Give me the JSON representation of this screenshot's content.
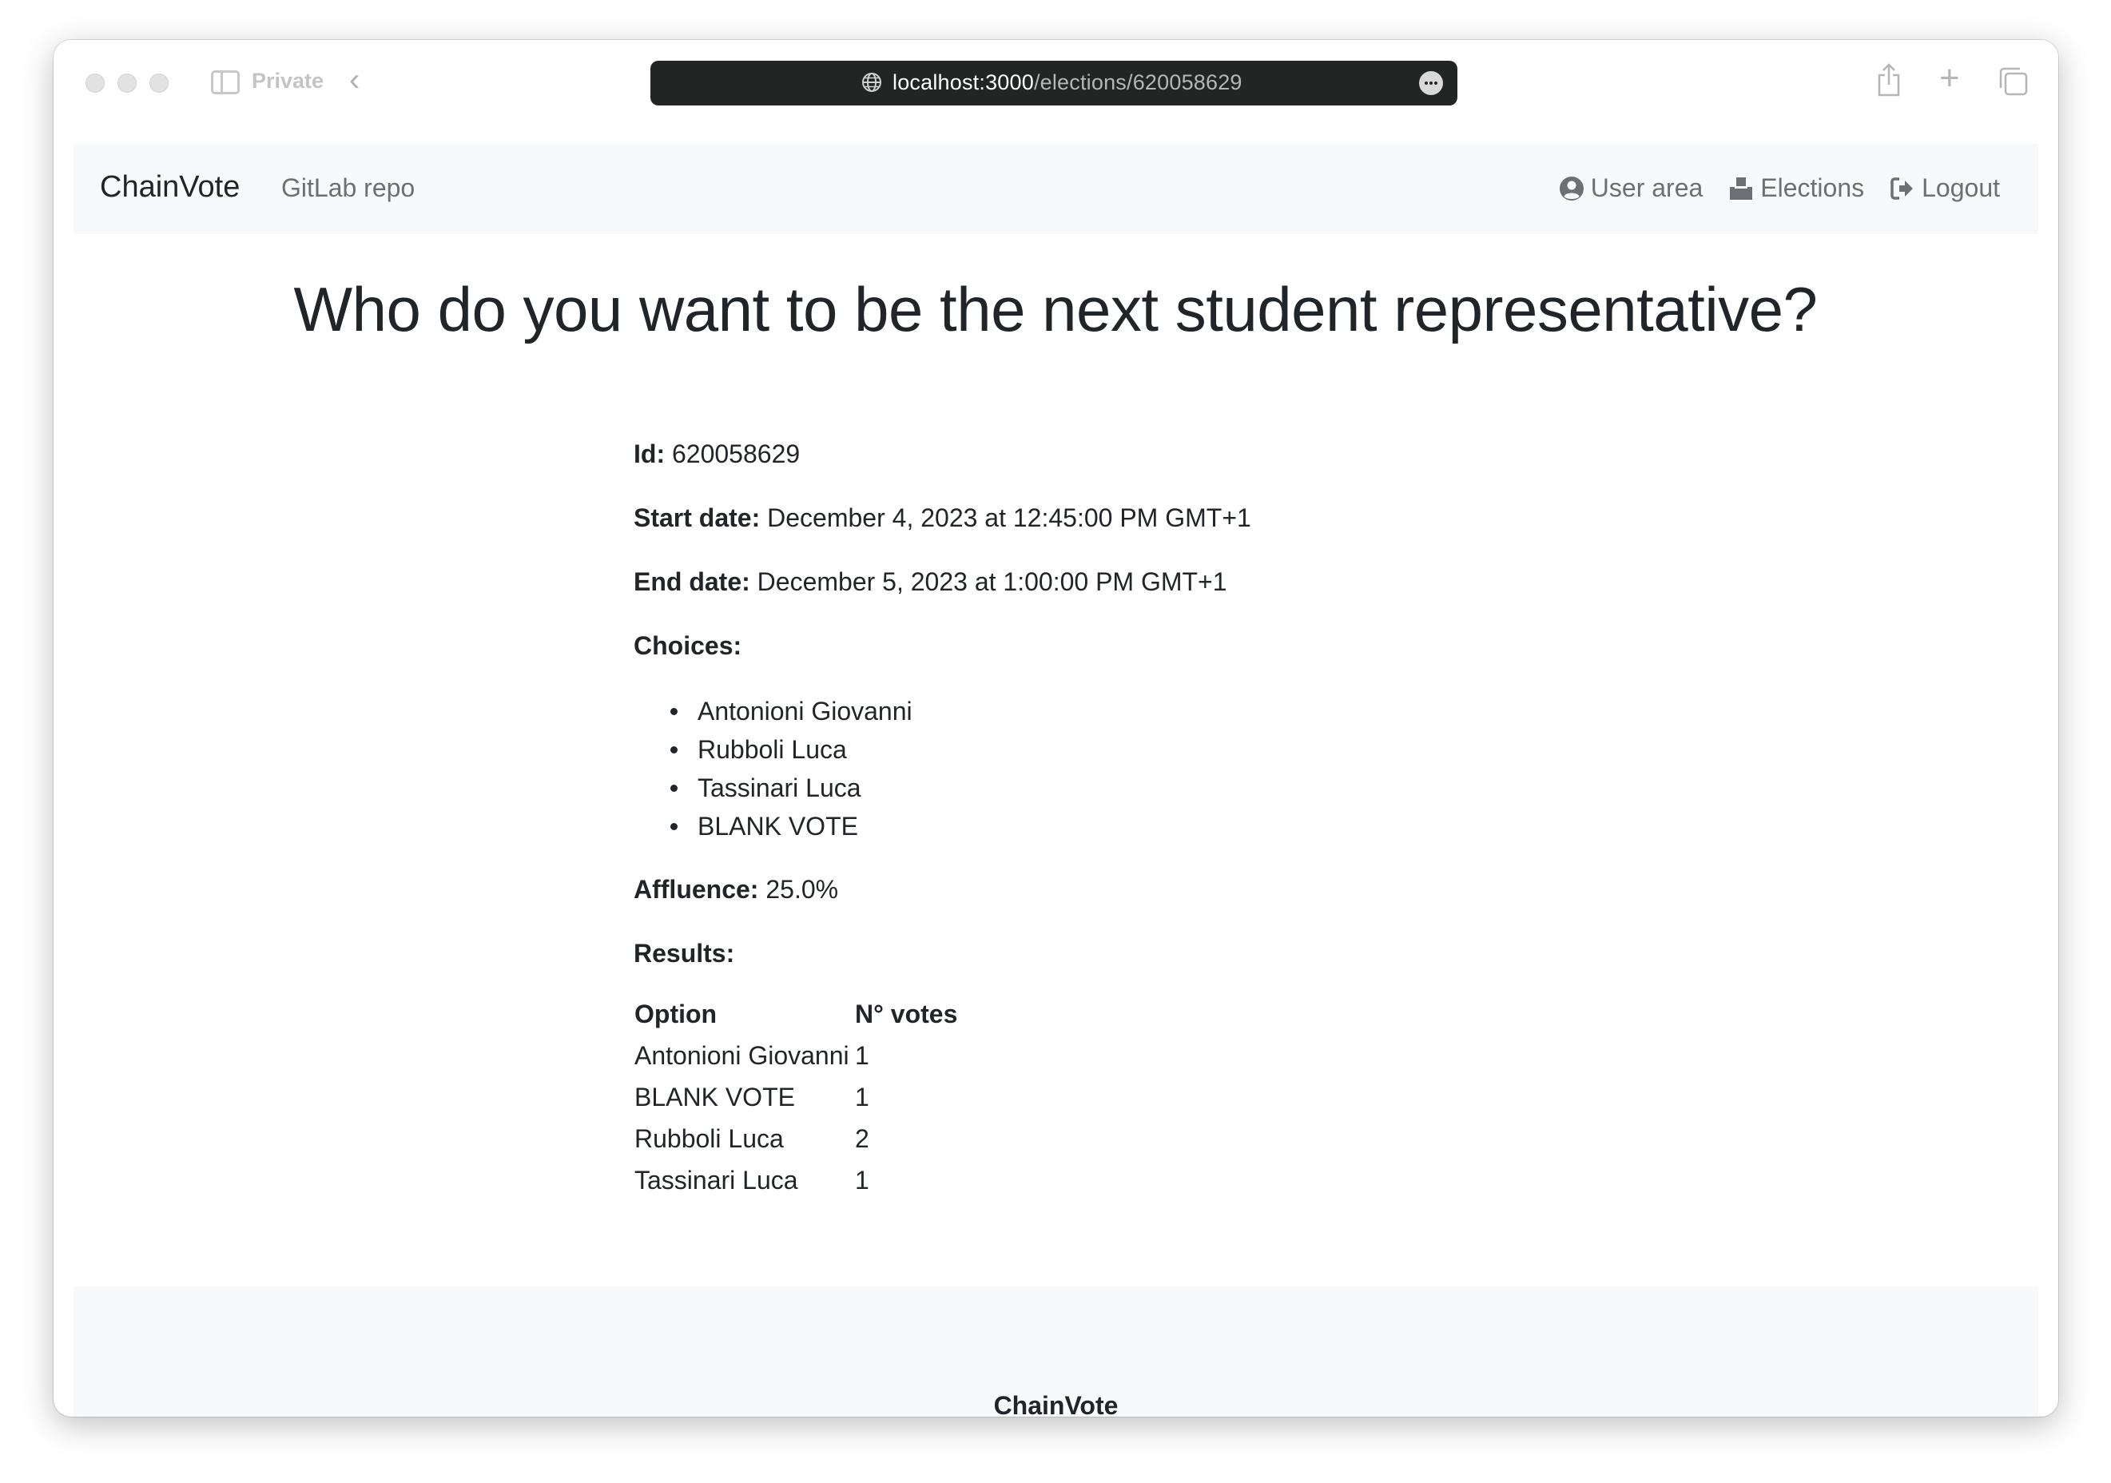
{
  "browser": {
    "private_label": "Private",
    "url_host": "localhost:3000",
    "url_path": "/elections/620058629"
  },
  "navbar": {
    "brand": "ChainVote",
    "gitlab_link": "GitLab repo",
    "user_area": "User area",
    "elections": "Elections",
    "logout": "Logout"
  },
  "election": {
    "title": "Who do you want to be the next student representative?",
    "id_label": "Id:",
    "id_value": "620058629",
    "start_label": "Start date:",
    "start_value": "December 4, 2023 at 12:45:00 PM GMT+1",
    "end_label": "End date:",
    "end_value": "December 5, 2023 at 1:00:00 PM GMT+1",
    "choices_label": "Choices:",
    "choices": [
      "Antonioni Giovanni",
      "Rubboli Luca",
      "Tassinari Luca",
      "BLANK VOTE"
    ],
    "affluence_label": "Affluence:",
    "affluence_value": "25.0%",
    "results_label": "Results:"
  },
  "results_table": {
    "headers": [
      "Option",
      "N° votes"
    ],
    "rows": [
      [
        "Antonioni Giovanni",
        "1"
      ],
      [
        "BLANK VOTE",
        "1"
      ],
      [
        "Rubboli Luca",
        "2"
      ],
      [
        "Tassinari Luca",
        "1"
      ]
    ]
  },
  "footer": {
    "brand": "ChainVote"
  }
}
